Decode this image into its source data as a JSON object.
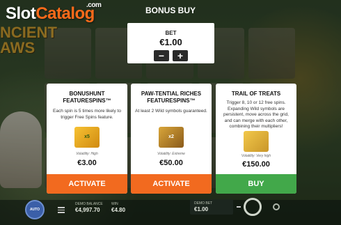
{
  "branding": {
    "logo_main": "Slot",
    "logo_accent": "Catalog",
    "logo_suffix": ".com"
  },
  "game": {
    "title_line1": "NCIENT",
    "title_line2": "AWS"
  },
  "dialog": {
    "title": "BONUS BUY",
    "bet": {
      "label": "BET",
      "value": "€1.00",
      "decrease": "−",
      "increase": "+"
    }
  },
  "cards": [
    {
      "title_line1": "BONUSHUNT",
      "title_line2": "FEATURESPINS™",
      "description": "Each spin is 5 times more likely to trigger Free Spins feature.",
      "image_text": "x5",
      "volatility": "Volatility: High",
      "price": "€3.00",
      "button": "ACTIVATE",
      "button_color": "#f26a1f"
    },
    {
      "title_line1": "PAW-TENTIAL RICHES",
      "title_line2": "FEATURESPINS™",
      "description": "At least 2 Wild symbols guaranteed.",
      "image_text": "x2",
      "volatility": "Volatility: Extreme",
      "price": "€50.00",
      "button": "ACTIVATE",
      "button_color": "#f26a1f"
    },
    {
      "title_line1": "TRAIL OF TREATS",
      "title_line2": "",
      "description": "Trigger 8, 10 or 12 free spins. Expanding Wild symbols are persistent, move across the grid, and can merge with each other, combining their multipliers!",
      "image_text": "",
      "volatility": "Volatility: Very high",
      "price": "€150.00",
      "button": "BUY",
      "button_color": "#42a84a"
    }
  ],
  "bottom_bar": {
    "autoplay_label": "AUTO",
    "balance_label": "DEMO BALANCE",
    "balance_value": "€4,997.70",
    "win_label": "WIN",
    "win_value": "€4.80",
    "bet_label": "DEMO BET",
    "bet_value": "€1.00"
  }
}
